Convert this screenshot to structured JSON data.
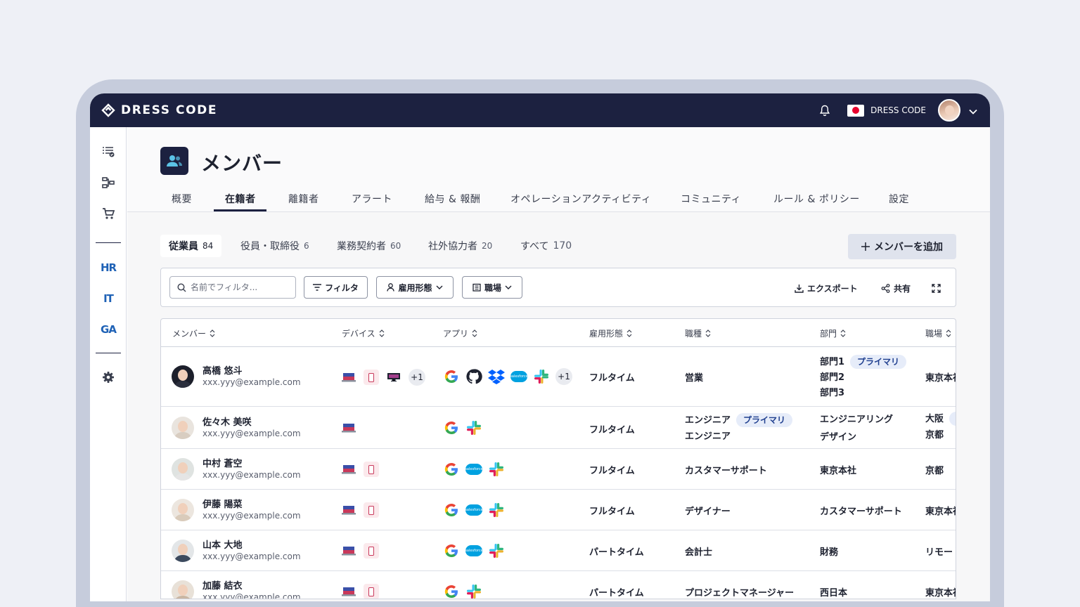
{
  "brand": {
    "name": "DRESS CODE"
  },
  "topbar": {
    "org_name": "DRESS CODE"
  },
  "sidebar": {
    "hr": "HR",
    "it": "IT",
    "ga": "GA"
  },
  "page": {
    "title": "メンバー"
  },
  "tabs": [
    "概要",
    "在籍者",
    "離籍者",
    "アラート",
    "給与 & 報酬",
    "オペレーションアクティビティ",
    "コミュニティ",
    "ルール & ポリシー",
    "設定"
  ],
  "chips": [
    {
      "label": "従業員",
      "count": "84"
    },
    {
      "label": "役員・取締役",
      "count": "6"
    },
    {
      "label": "業務契約者",
      "count": "60"
    },
    {
      "label": "社外協力者",
      "count": "20"
    },
    {
      "label": "すべて",
      "count": "170"
    }
  ],
  "add_button": "メンバーを追加",
  "filter": {
    "search_placeholder": "名前でフィルタ...",
    "filter_label": "フィルタ",
    "employment_label": "雇用形態",
    "workplace_label": "職場",
    "export_label": "エクスポート",
    "share_label": "共有"
  },
  "columns": [
    "メンバー",
    "デバイス",
    "アプリ",
    "雇用形態",
    "職種",
    "部門",
    "職場"
  ],
  "primary_badge": "プライマリ",
  "more_count": "+1",
  "rows": [
    {
      "name": "高橋 悠斗",
      "email": "xxx.yyy@example.com",
      "employment": "フルタイム",
      "job": "営業",
      "job2": "",
      "dept": "部門1",
      "dept2": "部門2",
      "dept3": "部門3",
      "workplace": "東京本社",
      "workplace2": ""
    },
    {
      "name": "佐々木 美咲",
      "email": "xxx.yyy@example.com",
      "employment": "フルタイム",
      "job": "エンジニア",
      "job2": "エンジニア",
      "dept": "エンジニアリング",
      "dept2": "デザイン",
      "dept3": "",
      "workplace": "大阪",
      "workplace2": "京都"
    },
    {
      "name": "中村 蒼空",
      "email": "xxx.yyy@example.com",
      "employment": "フルタイム",
      "job": "カスタマーサポート",
      "job2": "",
      "dept": "東京本社",
      "dept2": "",
      "dept3": "",
      "workplace": "京都",
      "workplace2": ""
    },
    {
      "name": "伊藤 陽菜",
      "email": "xxx.yyy@example.com",
      "employment": "フルタイム",
      "job": "デザイナー",
      "job2": "",
      "dept": "カスタマーサポート",
      "dept2": "",
      "dept3": "",
      "workplace": "東京本社",
      "workplace2": ""
    },
    {
      "name": "山本 大地",
      "email": "xxx.yyy@example.com",
      "employment": "パートタイム",
      "job": "会計士",
      "job2": "",
      "dept": "財務",
      "dept2": "",
      "dept3": "",
      "workplace": "リモート",
      "workplace2": ""
    },
    {
      "name": "加藤 結衣",
      "email": "xxx.yyy@example.com",
      "employment": "パートタイム",
      "job": "プロジェクトマネージャー",
      "job2": "",
      "dept": "西日本",
      "dept2": "",
      "dept3": "",
      "workplace": "東京本社",
      "workplace2": ""
    }
  ],
  "colors": {
    "navy": "#1c2140",
    "accent_blue": "#1f62b6",
    "badge_bg": "#e6ecf9"
  }
}
